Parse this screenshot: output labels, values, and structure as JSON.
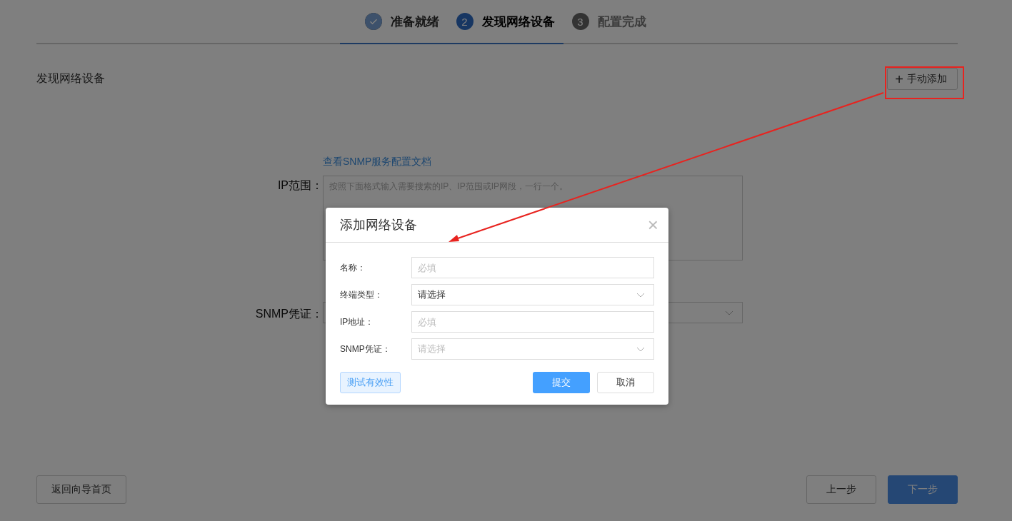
{
  "steps": [
    {
      "label": "准备就绪",
      "completed": true,
      "selected": false
    },
    {
      "label": "发现网络设备",
      "number": "2",
      "completed": false,
      "selected": true
    },
    {
      "label": "配置完成",
      "number": "3",
      "completed": false,
      "selected": false
    }
  ],
  "section_title": "发现网络设备",
  "add_button": {
    "icon": "+",
    "label": "手动添加"
  },
  "form": {
    "doc_link": "查看SNMP服务配置文档",
    "ip_range_label": "IP范围：",
    "ip_range_placeholder": "按照下面格式输入需要搜索的IP、IP范围或IP网段，一行一个。",
    "snmp_label": "SNMP凭证："
  },
  "footer": {
    "back_home": "返回向导首页",
    "prev": "上一步",
    "next": "下一步"
  },
  "dialog": {
    "title": "添加网络设备",
    "close": "×",
    "fields": [
      {
        "label": "名称：",
        "kind": "input",
        "placeholder": "必填"
      },
      {
        "label": "终端类型：",
        "kind": "select",
        "value": "请选择"
      },
      {
        "label": "IP地址：",
        "kind": "input",
        "placeholder": "必填"
      },
      {
        "label": "SNMP凭证：",
        "kind": "select",
        "placeholder": "请选择"
      }
    ],
    "test_button": "测试有效性",
    "submit_button": "提交",
    "cancel_button": "取消"
  }
}
